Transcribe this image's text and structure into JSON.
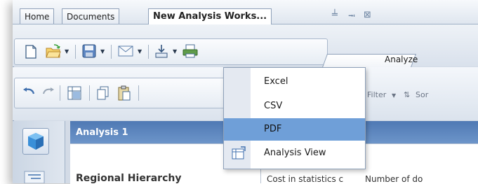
{
  "tabs": [
    {
      "label": "Home"
    },
    {
      "label": "Documents"
    },
    {
      "label": "New Analysis Works..."
    }
  ],
  "toolbar": {
    "icons": [
      "new-document-icon",
      "open-folder-icon",
      "save-icon",
      "email-icon",
      "export-icon",
      "print-icon"
    ],
    "analyze_tab": "Analyze",
    "filter_label": "Filter",
    "sort_label": "Sor"
  },
  "export_menu": {
    "items": [
      {
        "label": "Excel",
        "highlighted": false
      },
      {
        "label": "CSV",
        "highlighted": false
      },
      {
        "label": "PDF",
        "highlighted": true
      },
      {
        "label": "Analysis View",
        "highlighted": false,
        "icon": "analysis-view-icon"
      }
    ]
  },
  "analysis": {
    "title": "Analysis 1",
    "text_fragments": [
      "Regional Hierarchy",
      "Cost in statistics c",
      "Number of do"
    ]
  },
  "colors": {
    "header_blue": "#5b84bd",
    "menu_highlight": "#6f9fd8"
  }
}
